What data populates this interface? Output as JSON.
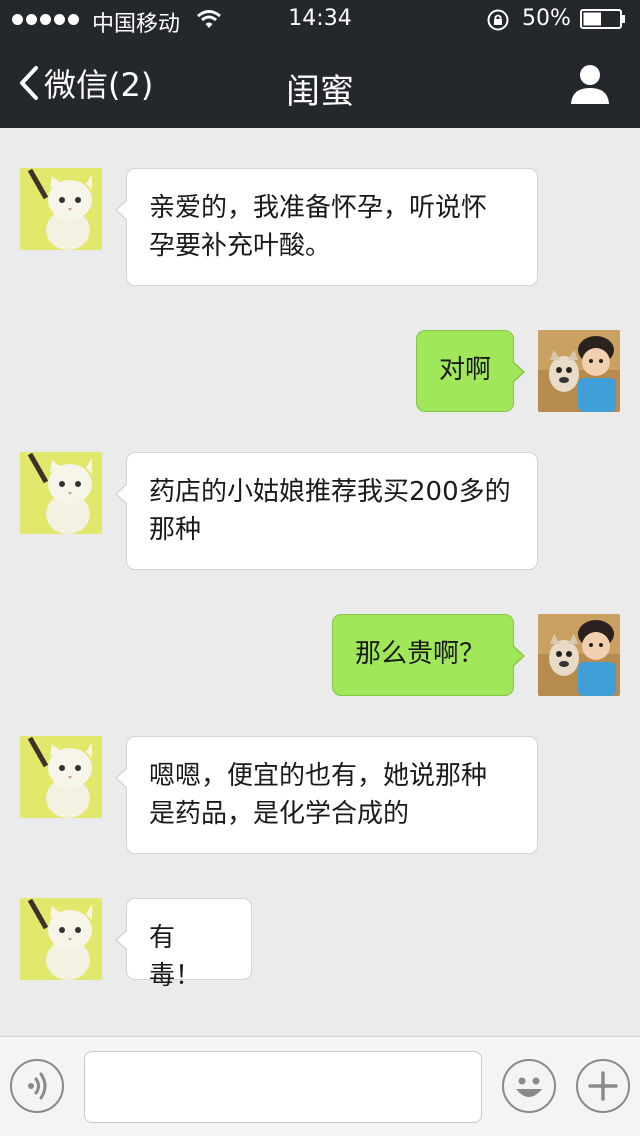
{
  "status_bar": {
    "carrier": "中国移动",
    "time": "14:34",
    "battery_percent": "50%",
    "battery_level": 0.5
  },
  "nav": {
    "back_label": "微信(2)",
    "title": "闺蜜"
  },
  "messages": [
    {
      "side": "in",
      "text": "亲爱的，我准备怀孕，听说怀孕要补充叶酸。"
    },
    {
      "side": "out",
      "text": "对啊"
    },
    {
      "side": "in",
      "text": "药店的小姑娘推荐我买200多的那种"
    },
    {
      "side": "out",
      "text": "那么贵啊？"
    },
    {
      "side": "in",
      "text": "嗯嗯，便宜的也有，她说那种是药品，是化学合成的"
    },
    {
      "side": "in",
      "text": "有毒！"
    }
  ],
  "input": {
    "value": "",
    "placeholder": ""
  },
  "icons": {
    "voice": "voice-icon",
    "emoji": "emoji-icon",
    "plus": "plus-icon",
    "profile": "profile-icon",
    "back": "chevron-left-icon"
  },
  "colors": {
    "header_bg": "#24272b",
    "chat_bg": "#ebebeb",
    "bubble_in": "#ffffff",
    "bubble_out": "#a0e759"
  }
}
